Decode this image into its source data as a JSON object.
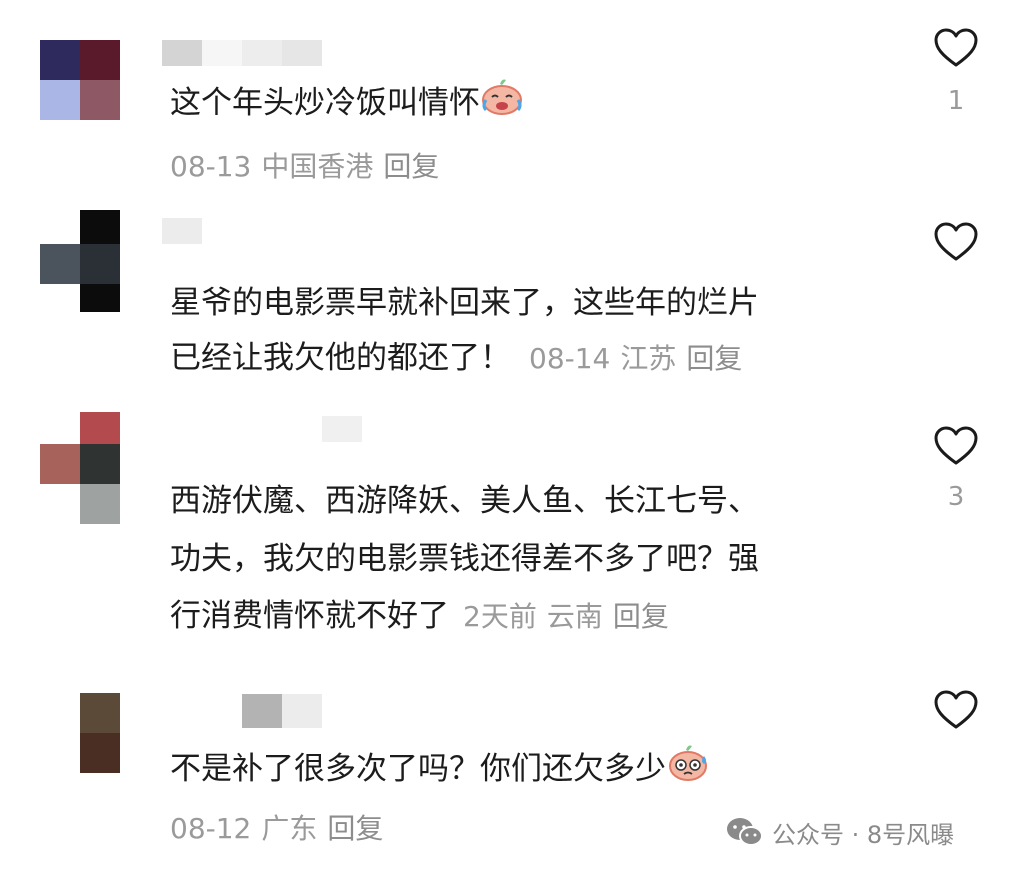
{
  "comments": [
    {
      "text": "这个年头炒冷饭叫情怀",
      "emoji": "laughing-crying-emoji",
      "date": "08-13",
      "location": "中国香港",
      "reply": "回复",
      "likes": "1"
    },
    {
      "text_line1": "星爷的电影票早就补回来了，这些年的烂片",
      "text_line2": "已经让我欠他的都还了！",
      "date": "08-14",
      "location": "江苏",
      "reply": "回复",
      "likes": ""
    },
    {
      "text_line1": "西游伏魔、西游降妖、美人鱼、长江七号、",
      "text_line2": "功夫，我欠的电影票钱还得差不多了吧？强",
      "text_line3": "行消费情怀就不好了",
      "date": "2天前",
      "location": "云南",
      "reply": "回复",
      "likes": "3"
    },
    {
      "text": "不是补了很多次了吗？你们还欠多少",
      "emoji": "sweating-emoji",
      "date": "08-12",
      "location": "广东",
      "reply": "回复",
      "likes": ""
    }
  ],
  "watermark": {
    "text": "公众号 · 8号风曝",
    "icon": "wechat-icon"
  },
  "colors": {
    "text": "#1c1c1c",
    "meta": "#9a9a9a",
    "heart_stroke": "#1b1b1b"
  }
}
